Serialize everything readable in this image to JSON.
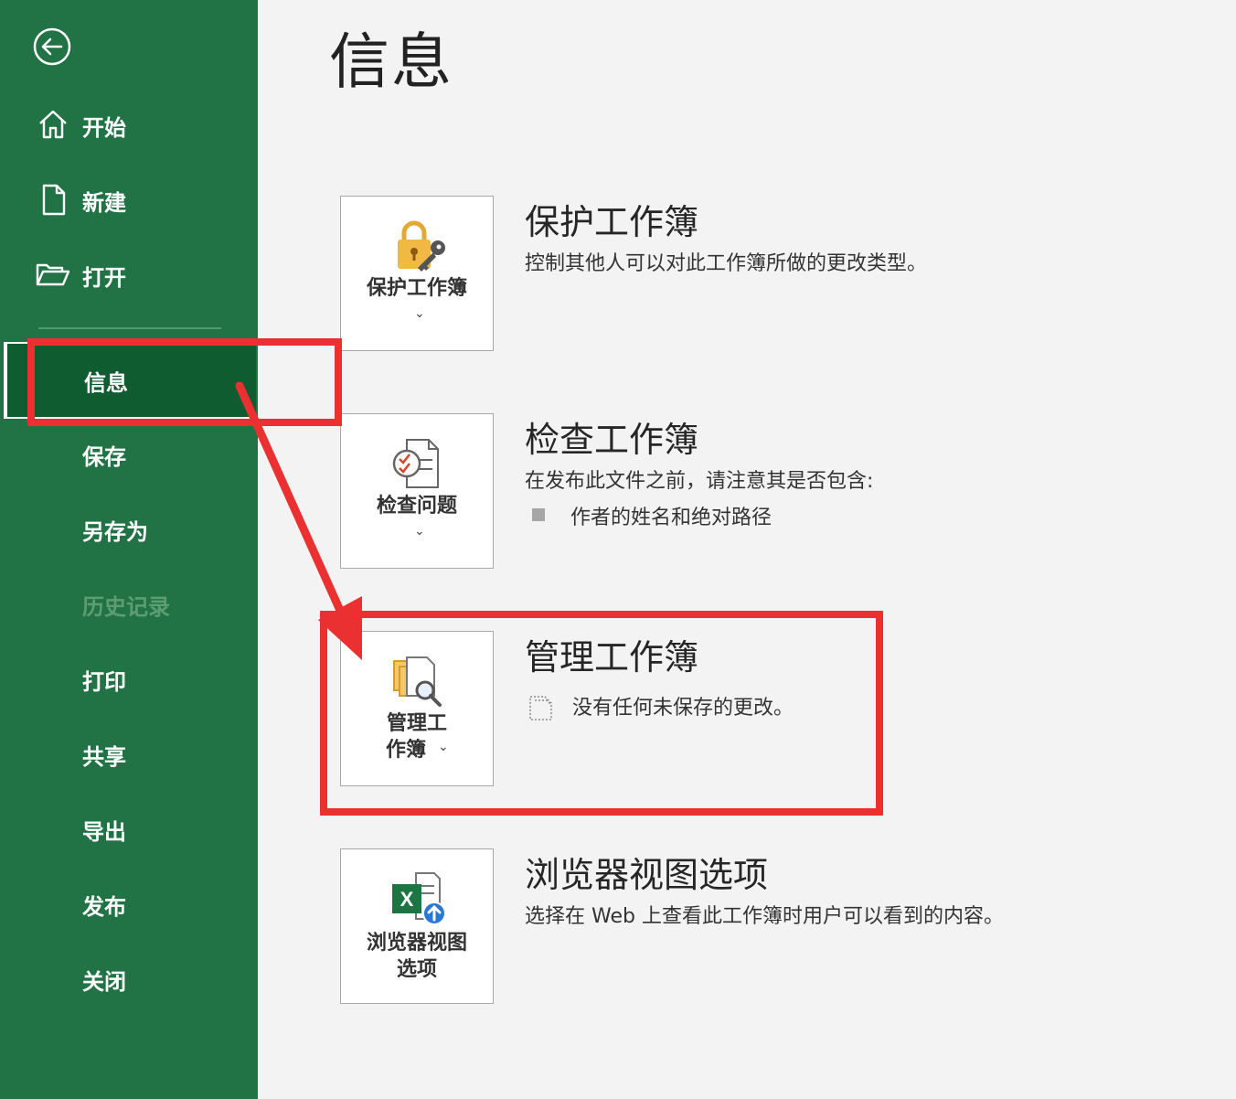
{
  "sidebar": {
    "back_icon": "back-arrow-icon",
    "items": [
      {
        "label": "开始",
        "icon": "home-icon"
      },
      {
        "label": "新建",
        "icon": "new-file-icon"
      },
      {
        "label": "打开",
        "icon": "open-folder-icon"
      },
      {
        "label": "信息",
        "selected": true
      },
      {
        "label": "保存"
      },
      {
        "label": "另存为"
      },
      {
        "label": "历史记录",
        "disabled": true
      },
      {
        "label": "打印"
      },
      {
        "label": "共享"
      },
      {
        "label": "导出"
      },
      {
        "label": "发布"
      },
      {
        "label": "关闭"
      }
    ]
  },
  "main": {
    "title": "信息",
    "sections": [
      {
        "tile_label": "保护工作簿",
        "tile_icon": "lock-key-icon",
        "title": "保护工作簿",
        "description": "控制其他人可以对此工作簿所做的更改类型。"
      },
      {
        "tile_label": "检查问题",
        "tile_icon": "inspect-document-icon",
        "title": "检查工作簿",
        "description": "在发布此文件之前，请注意其是否包含:",
        "bullet": "作者的姓名和绝对路径"
      },
      {
        "tile_label_line1": "管理工",
        "tile_label_line2": "作簿",
        "tile_icon": "manage-workbook-icon",
        "title": "管理工作簿",
        "status_icon": "document-dotted-icon",
        "description": "没有任何未保存的更改。"
      },
      {
        "tile_label_line1": "浏览器视图",
        "tile_label_line2": "选项",
        "tile_icon": "excel-browser-icon",
        "title": "浏览器视图选项",
        "description": "选择在 Web 上查看此工作簿时用户可以看到的内容。"
      }
    ]
  },
  "colors": {
    "sidebar_bg": "#217346",
    "sidebar_selected": "#0e5c2f",
    "annotation": "#ea3030",
    "main_bg": "#f3f3f3"
  }
}
